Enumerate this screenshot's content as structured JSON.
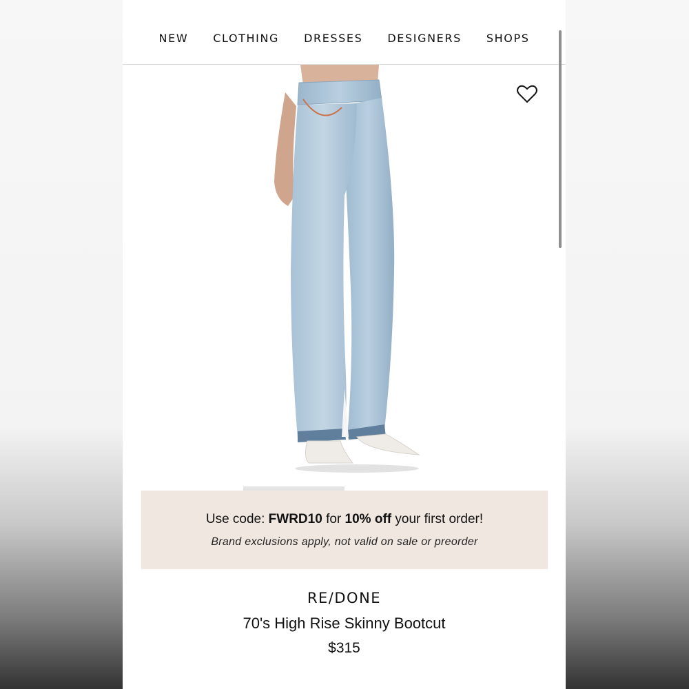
{
  "nav": {
    "items": [
      {
        "label": "NEW"
      },
      {
        "label": "CLOTHING"
      },
      {
        "label": "DRESSES"
      },
      {
        "label": "DESIGNERS"
      },
      {
        "label": "SHOPS"
      }
    ]
  },
  "product_image": {
    "icon": "jeans-product-photo"
  },
  "wishlist": {
    "icon": "heart-outline-icon"
  },
  "promo": {
    "prefix": "Use code: ",
    "code": "FWRD10",
    "middle": " for ",
    "discount": "10% off",
    "suffix": " your first order!",
    "note": "Brand exclusions apply, not valid on sale or preorder",
    "background": "#f0e7e1"
  },
  "product": {
    "brand": "RE/DONE",
    "name": "70's High Rise Skinny Bootcut",
    "price": "$315"
  }
}
